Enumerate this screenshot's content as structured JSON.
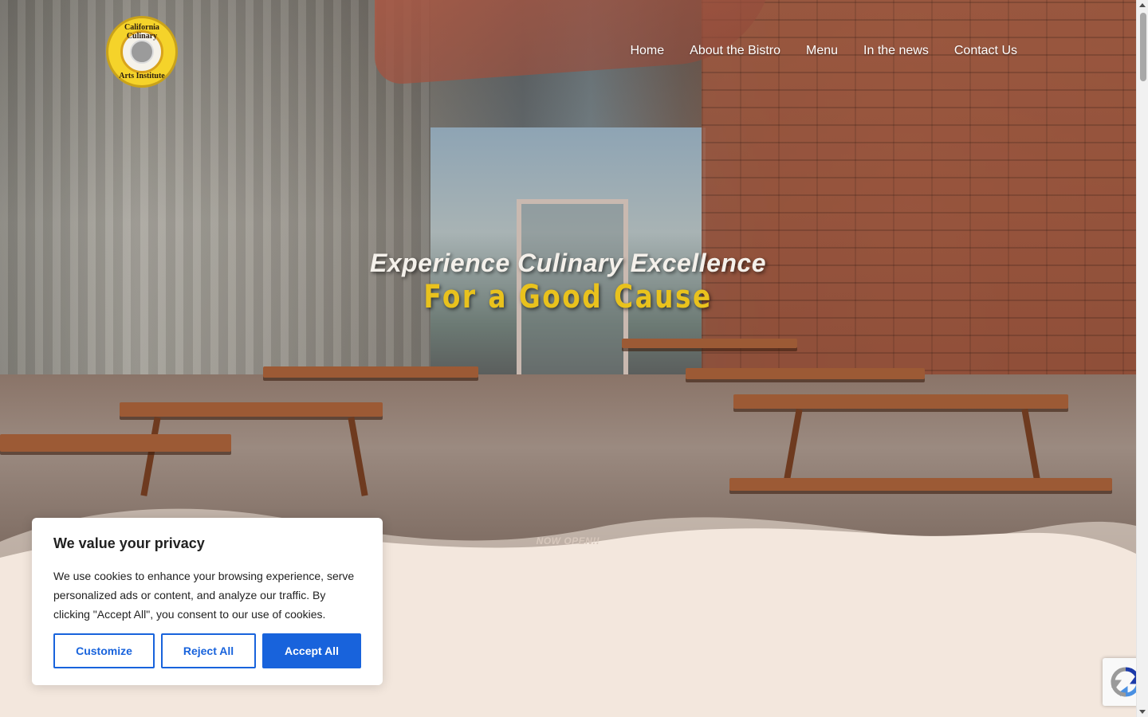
{
  "logo": {
    "alt_top": "California Culinary",
    "alt_bottom": "Arts Institute"
  },
  "nav": {
    "items": [
      {
        "label": "Home"
      },
      {
        "label": "About the Bistro"
      },
      {
        "label": "Menu"
      },
      {
        "label": "In the news"
      },
      {
        "label": "Contact Us"
      }
    ]
  },
  "hero": {
    "headline": "Experience Culinary Excellence",
    "subheadline": "For a Good Cause",
    "ribbon_text": "NOW OPEN!!"
  },
  "cookie_banner": {
    "title": "We value your privacy",
    "body": "We use cookies to enhance your browsing experience, serve personalized ads or content, and analyze our traffic. By clicking \"Accept All\", you consent to our use of cookies.",
    "customize_label": "Customize",
    "reject_label": "Reject All",
    "accept_label": "Accept All"
  },
  "colors": {
    "accent_blue": "#1863dc",
    "hero_yellow": "#e9c21d",
    "page_bg": "#f3e7dd"
  },
  "icons": {
    "recaptcha": "recaptcha-icon",
    "scroll_up": "chevron-up-icon",
    "scroll_down": "chevron-down-icon"
  }
}
